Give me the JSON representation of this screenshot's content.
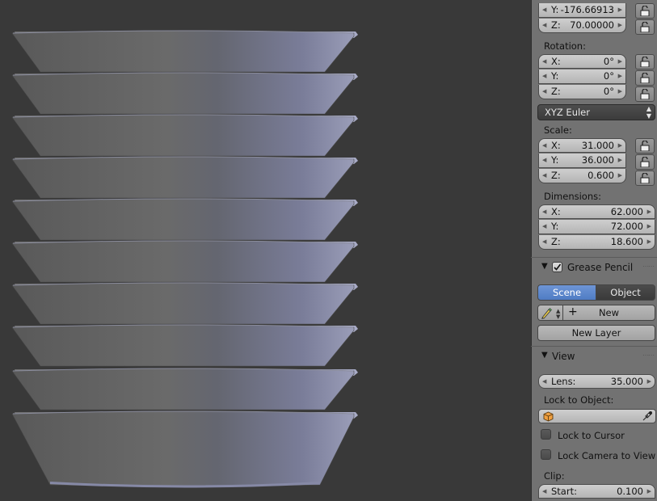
{
  "location": {
    "y": {
      "axis": "Y:",
      "value": "-176.66913"
    },
    "z": {
      "axis": "Z:",
      "value": "70.00000"
    }
  },
  "rotation": {
    "label": "Rotation:",
    "x": {
      "axis": "X:",
      "value": "0°"
    },
    "y": {
      "axis": "Y:",
      "value": "0°"
    },
    "z": {
      "axis": "Z:",
      "value": "0°"
    },
    "mode": "XYZ Euler"
  },
  "scale": {
    "label": "Scale:",
    "x": {
      "axis": "X:",
      "value": "31.000"
    },
    "y": {
      "axis": "Y:",
      "value": "36.000"
    },
    "z": {
      "axis": "Z:",
      "value": "0.600"
    }
  },
  "dimensions": {
    "label": "Dimensions:",
    "x": {
      "axis": "X:",
      "value": "62.000"
    },
    "y": {
      "axis": "Y:",
      "value": "72.000"
    },
    "z": {
      "axis": "Z:",
      "value": "18.600"
    }
  },
  "grease_pencil": {
    "title": "Grease Pencil",
    "tab_scene": "Scene",
    "tab_object": "Object",
    "new_label": "New",
    "new_layer_label": "New Layer"
  },
  "view": {
    "title": "View",
    "lens_label": "Lens:",
    "lens_value": "35.000",
    "lock_to_object_label": "Lock to Object:",
    "lock_to_cursor_label": "Lock to Cursor",
    "lock_camera_label": "Lock Camera to View",
    "clip_label": "Clip:",
    "clip_start_label": "Start:",
    "clip_start_value": "0.100"
  },
  "colors": {
    "viewport_bg": "#393939",
    "panel_bg": "#727272",
    "accent_blue": "#5680c2"
  }
}
